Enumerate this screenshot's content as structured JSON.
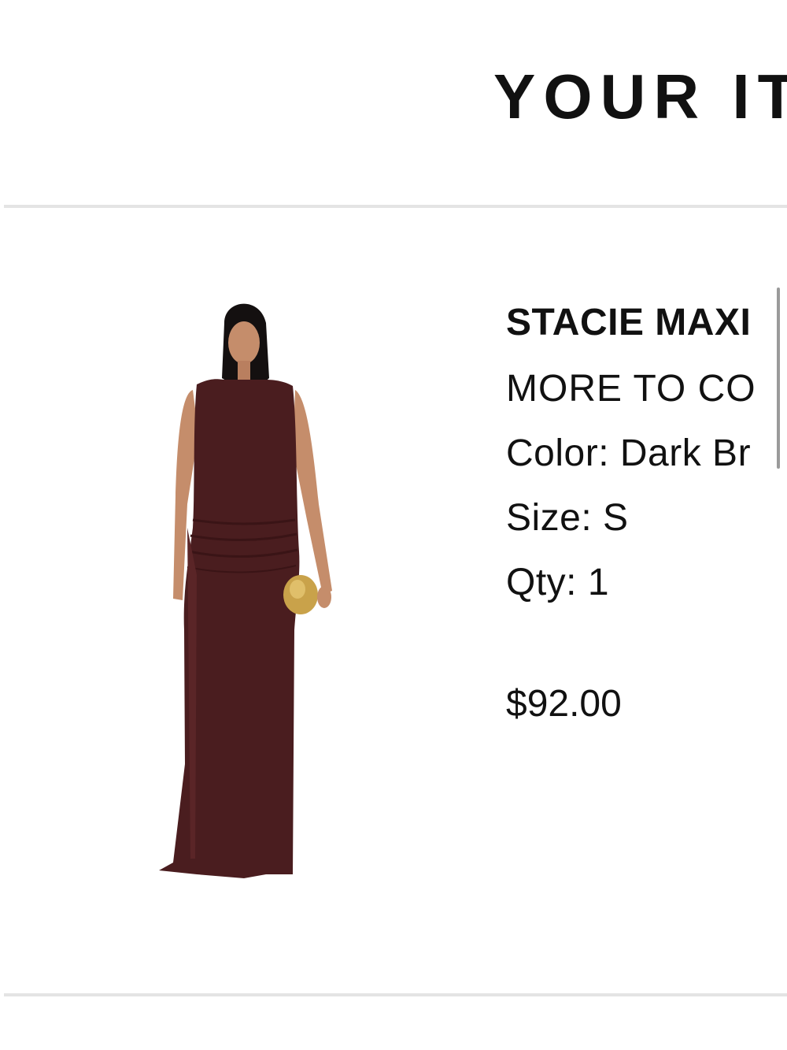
{
  "header": {
    "title": "YOUR IT"
  },
  "item": {
    "name": "STACIE MAXI",
    "brand": "MORE TO CO",
    "color_line": "Color: Dark Br",
    "size_line": "Size: S",
    "qty_line": "Qty: 1",
    "price": "$92.00",
    "image": {
      "icon": "dress-photo",
      "dress_color": "#4a1d1f",
      "clutch_color": "#c9a24a"
    }
  }
}
